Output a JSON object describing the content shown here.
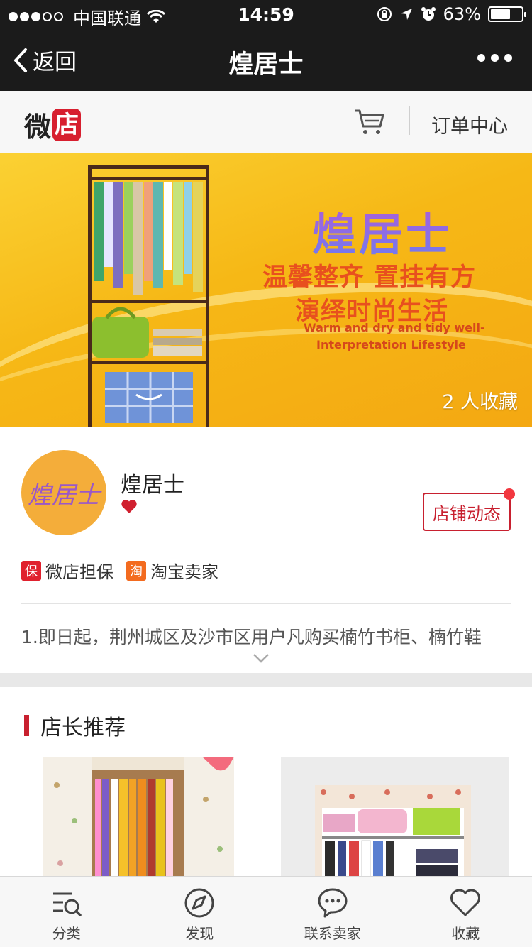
{
  "status": {
    "carrier": "中国联通",
    "time": "14:59",
    "battery": "63%",
    "battery_level": 0.63
  },
  "nav": {
    "back_label": "返回",
    "title": "煌居士"
  },
  "shop_header": {
    "logo_part1": "微",
    "logo_part2": "店",
    "orders_label": "订单中心"
  },
  "banner": {
    "brand": "煌居士",
    "slogan_line1": "温馨整齐 置挂有方",
    "slogan_line2": "演绎时尚生活",
    "english_line1": "Warm and dry and tidy well-",
    "english_line2": "Interpretation Lifestyle",
    "favorites": "2 人收藏"
  },
  "shop": {
    "avatar_text": "煌居士",
    "name": "煌居士",
    "news_button": "店铺动态",
    "badges": [
      {
        "icon": "保",
        "label": "微店担保"
      },
      {
        "icon": "淘",
        "label": "淘宝卖家"
      }
    ],
    "notice": "1.即日起，荆州城区及沙市区用户凡购买楠竹书柜、楠竹鞋"
  },
  "recommend": {
    "title": "店长推荐"
  },
  "tabbar": {
    "items": [
      {
        "label": "分类",
        "icon": "category-search-icon"
      },
      {
        "label": "发现",
        "icon": "compass-icon"
      },
      {
        "label": "联系卖家",
        "icon": "chat-icon"
      },
      {
        "label": "收藏",
        "icon": "heart-icon"
      }
    ]
  },
  "colors": {
    "accent": "#c8202f",
    "navbar": "#1b1b1b",
    "banner": "#f6b816"
  }
}
